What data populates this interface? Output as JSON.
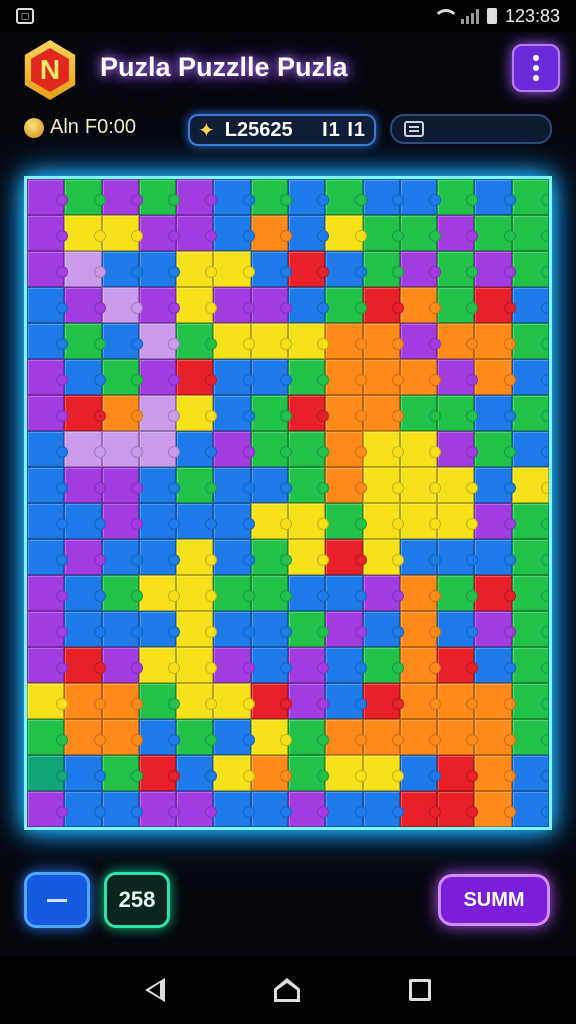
{
  "status_bar": {
    "time": "123:83"
  },
  "header": {
    "title": "Puzla Puzzlle Puzla",
    "logo_letter": "N",
    "menu_icon": "more-vertical-icon"
  },
  "stats": {
    "timer_prefix": "Aln",
    "timer_value": "F0:00",
    "score": "L25625",
    "score_extra": "I1 I1",
    "info_icon": "document-icon"
  },
  "board": {
    "columns": 14,
    "rows": 18,
    "palette": {
      "p": "#a33ce0",
      "b": "#1e7ae8",
      "g": "#22c24a",
      "y": "#f7e21a",
      "o": "#ff8a1a",
      "r": "#e8202a",
      "l": "#c99bea",
      "t": "#13a57a",
      "m": "#d42ca8"
    },
    "grid": [
      "pgpgpbgbgbbgbg",
      "pyyppbobyggpgg",
      "plbbyybrbgpgpg",
      "bplpyppbgrogrb",
      "bgblgyyyoopoog",
      "pbgprbbgooopob",
      "prolybgrooggbg",
      "blllbpggoyypgb",
      "bppbgbbgoyyyby",
      "bbpbbbyygyyypg",
      "bpbbybgyrybbbg",
      "pbgyyggbbpogrg",
      "pbbbybbgpbobpg",
      "prpyypbpbgorbg",
      "yoogyyrpbrooog",
      "goobgbygooooog",
      "tbgrbyogyybrob",
      "pbbppbbpbbrrob"
    ]
  },
  "controls": {
    "minus_icon": "minus-icon",
    "count": "258",
    "submit_label": "SUMM"
  },
  "nav": {
    "back_icon": "back-icon",
    "home_icon": "home-icon",
    "recent_icon": "recent-apps-icon"
  }
}
